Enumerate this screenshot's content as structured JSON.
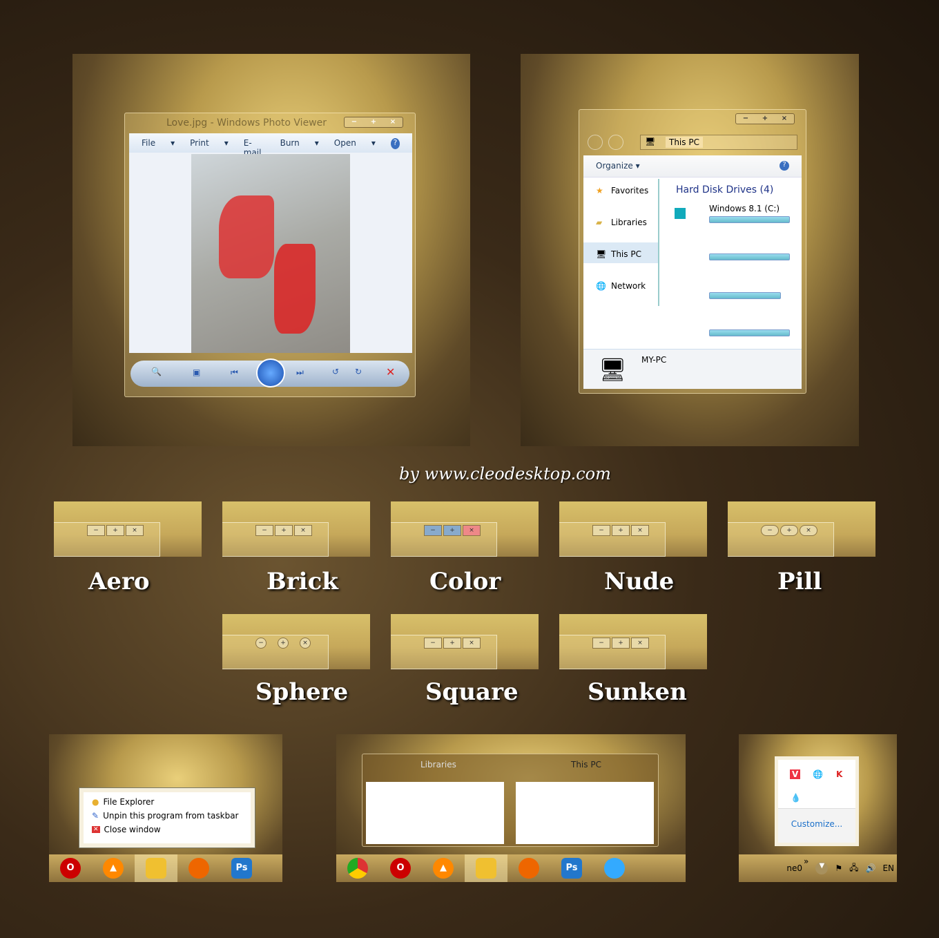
{
  "photo_viewer": {
    "title": "Love.jpg - Windows Photo Viewer",
    "menu": [
      "File",
      "Print",
      "E-mail",
      "Burn",
      "Open"
    ],
    "caption_buttons": [
      "−",
      "+",
      "×"
    ]
  },
  "explorer": {
    "address": "This PC",
    "organize": "Organize",
    "nav": [
      "Favorites",
      "Libraries",
      "This PC",
      "Network"
    ],
    "group_header": "Hard Disk Drives (4)",
    "drive_label": "Windows 8.1 (C:)",
    "drive_usage": [
      0.97,
      0.96,
      0.88,
      0.97
    ],
    "details_name": "MY-PC"
  },
  "credit": "by www.cleodesktop.com",
  "styles": [
    "Aero",
    "Brick",
    "Color",
    "Nude",
    "Pill",
    "Sphere",
    "Square",
    "Sunken"
  ],
  "jumplist": {
    "items": [
      "File Explorer",
      "Unpin this program from taskbar",
      "Close window"
    ]
  },
  "thumbnails": {
    "libraries_title": "Libraries",
    "thispc_title": "This PC"
  },
  "tray": {
    "customize": "Customize...",
    "user": "ne0",
    "chevron": "»",
    "lang": "EN"
  },
  "colors": {
    "accent": "#c9aa60",
    "link": "#1a6fc9"
  }
}
